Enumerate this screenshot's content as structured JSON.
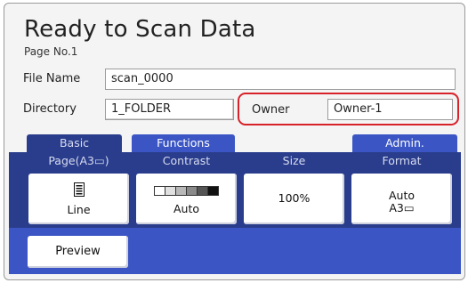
{
  "header": {
    "title": "Ready to Scan Data",
    "page_no": "Page No.1"
  },
  "file_name": {
    "label": "File Name",
    "value": "scan_0000"
  },
  "directory": {
    "label": "Directory",
    "value": "1_FOLDER"
  },
  "owner": {
    "label": "Owner",
    "value": "Owner-1"
  },
  "tabs": {
    "basic": "Basic",
    "functions": "Functions",
    "admin": "Admin."
  },
  "settings": {
    "page": {
      "label": "Page(A3▭)",
      "value": "Line"
    },
    "contrast": {
      "label": "Contrast",
      "value": "Auto"
    },
    "size": {
      "label": "Size",
      "value": "100%"
    },
    "format": {
      "label": "Format",
      "value": "Auto",
      "value2": "A3▭"
    }
  },
  "preview_label": "Preview",
  "colors": {
    "tab_dark": "#2a3d8c",
    "tab_light": "#3b56c4",
    "highlight": "#d8222a"
  },
  "icons": {
    "page": "document-lines-icon",
    "contrast": "contrast-gauge-icon",
    "orientation": "landscape-paper-icon"
  }
}
